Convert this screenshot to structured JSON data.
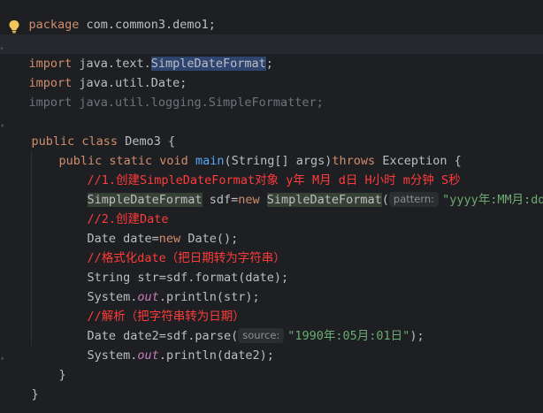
{
  "code": {
    "package_kw": "package",
    "package_name": " com.common3.demo1;",
    "import_kw": "import",
    "import1_pre": " java.text.",
    "import1_cls": "SimpleDateFormat",
    "import1_end": ";",
    "import2_rest": " java.util.Date;",
    "import3": "import java.util.logging.SimpleFormatter;",
    "class_kw": "public class",
    "class_name": " Demo3 {",
    "main_kw1": "public static void",
    "main_name": "main",
    "main_params": "(String[] args)",
    "main_throws": "throws",
    "main_exc": " Exception {",
    "comment1": "//1.创建SimpleDateFormat对象 y年 M月 d日 H小时 m分钟 S秒",
    "sdf_type": "SimpleDateFormat",
    "sdf_assign": " sdf=",
    "new_kw": "new",
    "sdf_ctor": "SimpleDateFormat",
    "open_paren": "(",
    "hint_pattern": "pattern:",
    "pattern_str": "\"yyyy年:MM月:dd日\"",
    "close_stmt": ");",
    "comment2": "//2.创建Date",
    "date_decl": "Date date=",
    "date_ctor": " Date();",
    "comment3": "//格式化date（把日期转为字符串）",
    "str_decl": "String str=sdf.format(date);",
    "sys": "System.",
    "out": "out",
    "println_str": ".println(str);",
    "comment4": "//解析（把字符串转为日期）",
    "date2_decl": "Date date2=sdf.parse(",
    "hint_source": "source:",
    "source_str": "\"1990年:05月:01日\"",
    "println_date2": ".println(date2);",
    "close_method": "}",
    "close_class": "}"
  }
}
